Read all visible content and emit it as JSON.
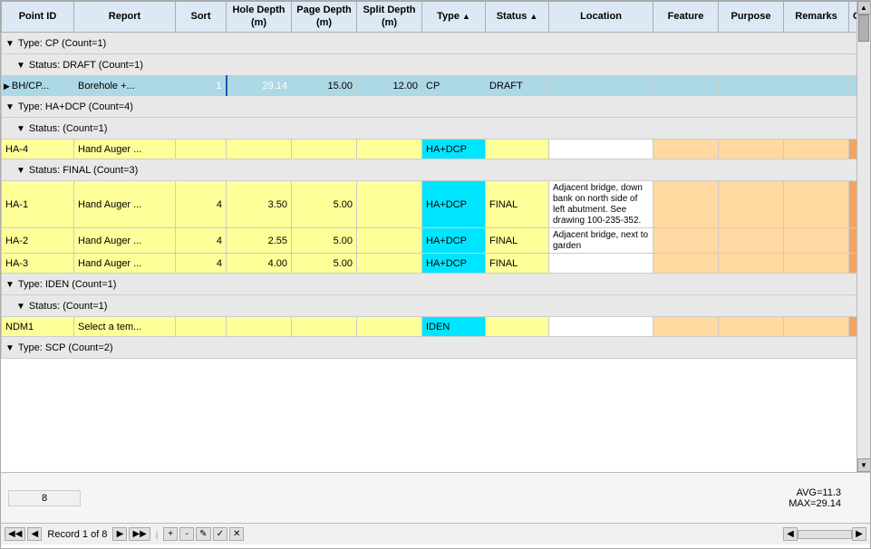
{
  "columns": [
    {
      "key": "pointid",
      "label": "Point ID",
      "sortable": false
    },
    {
      "key": "report",
      "label": "Report",
      "sortable": false
    },
    {
      "key": "sort",
      "label": "Sort",
      "sortable": false
    },
    {
      "key": "holedepth",
      "label": "Hole Depth (m)",
      "sortable": false
    },
    {
      "key": "pagedepth",
      "label": "Page Depth (m)",
      "sortable": false
    },
    {
      "key": "splitdepth",
      "label": "Split Depth (m)",
      "sortable": false
    },
    {
      "key": "type",
      "label": "Type",
      "sortable": true
    },
    {
      "key": "status",
      "label": "Status",
      "sortable": true
    },
    {
      "key": "location",
      "label": "Location",
      "sortable": false
    },
    {
      "key": "feature",
      "label": "Feature",
      "sortable": false
    },
    {
      "key": "purpose",
      "label": "Purpose",
      "sortable": false
    },
    {
      "key": "remarks",
      "label": "Remarks",
      "sortable": false
    },
    {
      "key": "cont",
      "label": "Cont",
      "sortable": false
    }
  ],
  "groups": [
    {
      "type_label": "Type: CP (Count=1)",
      "sub_groups": [
        {
          "status_label": "Status: DRAFT (Count=1)",
          "rows": [
            {
              "arrow": "▶",
              "pointid": "BH/CP...",
              "report": "Borehole +...",
              "sort": "1",
              "holedepth": "29.14",
              "pagedepth": "15.00",
              "splitdepth": "12.00",
              "type": "CP",
              "status": "DRAFT",
              "location": "",
              "feature": "",
              "purpose": "",
              "remarks": "",
              "style": "cp"
            }
          ]
        }
      ]
    },
    {
      "type_label": "Type: HA+DCP (Count=4)",
      "sub_groups": [
        {
          "status_label": "Status:  (Count=1)",
          "rows": [
            {
              "arrow": "",
              "pointid": "HA-4",
              "report": "Hand Auger ...",
              "sort": "",
              "holedepth": "",
              "pagedepth": "",
              "splitdepth": "",
              "type": "HA+DCP",
              "status": "",
              "location": "",
              "feature": "",
              "purpose": "",
              "remarks": "",
              "style": "ha"
            }
          ]
        },
        {
          "status_label": "Status: FINAL (Count=3)",
          "rows": [
            {
              "arrow": "",
              "pointid": "HA-1",
              "report": "Hand Auger ...",
              "sort": "4",
              "holedepth": "3.50",
              "pagedepth": "5.00",
              "splitdepth": "",
              "type": "HA+DCP",
              "status": "FINAL",
              "location": "Adjacent bridge, down bank on north side of left abutment. See drawing 100-235-352.",
              "feature": "",
              "purpose": "",
              "remarks": "",
              "style": "ha-final"
            },
            {
              "arrow": "",
              "pointid": "HA-2",
              "report": "Hand Auger ...",
              "sort": "4",
              "holedepth": "2.55",
              "pagedepth": "5.00",
              "splitdepth": "",
              "type": "HA+DCP",
              "status": "FINAL",
              "location": "Adjacent bridge, next to garden",
              "feature": "",
              "purpose": "",
              "remarks": "",
              "style": "ha"
            },
            {
              "arrow": "",
              "pointid": "HA-3",
              "report": "Hand Auger ...",
              "sort": "4",
              "holedepth": "4.00",
              "pagedepth": "5.00",
              "splitdepth": "",
              "type": "HA+DCP",
              "status": "FINAL",
              "location": "",
              "feature": "",
              "purpose": "",
              "remarks": "",
              "style": "ha"
            }
          ]
        }
      ]
    },
    {
      "type_label": "Type: IDEN (Count=1)",
      "sub_groups": [
        {
          "status_label": "Status:  (Count=1)",
          "rows": [
            {
              "arrow": "",
              "pointid": "NDM1",
              "report": "Select a tem...",
              "sort": "",
              "holedepth": "",
              "pagedepth": "",
              "splitdepth": "",
              "type": "IDEN",
              "status": "",
              "location": "",
              "feature": "",
              "purpose": "",
              "remarks": "",
              "style": "ha"
            }
          ]
        }
      ]
    },
    {
      "type_label": "Type: SCP (Count=2)",
      "sub_groups": []
    }
  ],
  "footer": {
    "count": "8",
    "avg_label": "AVG=11.3",
    "max_label": "MAX=29.14"
  },
  "nav": {
    "record_text": "Record 1 of 8"
  },
  "icons": {
    "first": "◀◀",
    "prev": "◀",
    "next": "▶",
    "last": "▶▶",
    "add": "+",
    "delete": "-",
    "edit": "✎",
    "check": "✓",
    "cancel": "✕",
    "scroll_up": "▲",
    "scroll_down": "▼",
    "scroll_left": "◀",
    "scroll_right": "▶",
    "collapse": "▼",
    "expand": "▶",
    "row_arrow": "▶"
  }
}
